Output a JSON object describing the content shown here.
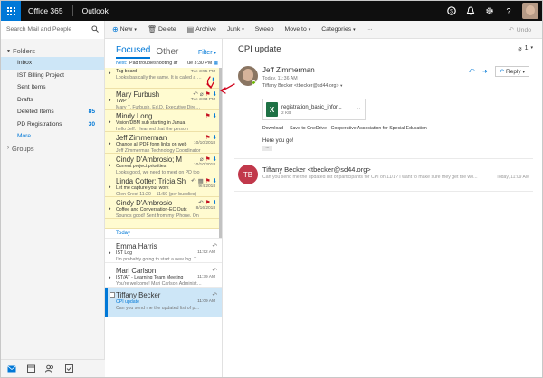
{
  "topbar": {
    "brand": "Office 365",
    "app": "Outlook"
  },
  "commands": {
    "search_placeholder": "Search Mail and People",
    "new": "New",
    "delete": "Delete",
    "archive": "Archive",
    "junk": "Junk",
    "sweep": "Sweep",
    "move_to": "Move to",
    "categories": "Categories",
    "undo": "Undo"
  },
  "nav": {
    "folders_label": "Folders",
    "items": [
      {
        "label": "Inbox",
        "count": ""
      },
      {
        "label": "IST Billing Project",
        "count": ""
      },
      {
        "label": "Sent Items",
        "count": ""
      },
      {
        "label": "Drafts",
        "count": ""
      },
      {
        "label": "Deleted Items",
        "count": "85"
      },
      {
        "label": "PD Registrations",
        "count": "30"
      }
    ],
    "more": "More",
    "groups_label": "Groups"
  },
  "list": {
    "tab_focused": "Focused",
    "tab_other": "Other",
    "filter": "Filter",
    "next_label": "Next:",
    "next_text": "iPad troubleshooting ar",
    "next_time": "Tue 3:30 PM",
    "today_label": "Today",
    "pinned": [
      {
        "from": "",
        "subject": "Tag board",
        "preview": "Looks basically the same. It is called a Tag board.",
        "time": "Tue 3:55 PM"
      },
      {
        "from": "Mary Furbush",
        "subject": "TWP",
        "preview": "Mary T. Furbush, Ed.D. Executive Director, SAU 44",
        "time": "Tue 3:03 PM"
      },
      {
        "from": "Mindy Long",
        "subject": "Vision/DBM sub starting in Janua",
        "preview": "hello Jeff.  I learned that the person",
        "time": ""
      },
      {
        "from": "Jeff Zimmerman",
        "subject": "Change all PDF form links on web",
        "preview": "Jeff Zimmerman Technology Coordinator",
        "time": "10/10/2018"
      },
      {
        "from": "Cindy D'Ambrosio; M",
        "subject": "Current project priorities",
        "preview": "Looks good, we need to meet on PD too",
        "time": "10/10/2018"
      },
      {
        "from": "Linda Cotter; Tricia Sh",
        "subject": "Let me capture your work",
        "preview": "Glen Crest 11:20 – 11:59 (per buddies)",
        "time": "9/4/2018"
      },
      {
        "from": "Cindy D'Ambrosio",
        "subject": "Coffee and Conversation-EC Outc",
        "preview": "Sounds good! Sent from my iPhone. On",
        "time": "8/16/2018"
      }
    ],
    "today": [
      {
        "from": "Emma Harris",
        "subject": "IST Log",
        "preview": "I'm probably going to start a new log. This",
        "time": "11:52 AM"
      },
      {
        "from": "Mari Carlson",
        "subject": "IST/AT - Learning Team Meeting",
        "preview": "You're welcome! Mari Carlson Administrative",
        "time": "11:39 AM"
      },
      {
        "from": "Tiffany Becker",
        "subject": "CPI update",
        "preview": "Can you send me the updated list of partici",
        "time": "11:09 AM"
      }
    ]
  },
  "reading": {
    "title": "CPI update",
    "count": "1",
    "sender_name": "Jeff Zimmerman",
    "sender_time": "Today, 11:36 AM",
    "sender_to": "Tiffany Becker <tbecker@sd44.org>",
    "reply_label": "Reply",
    "attachment_name": "registration_basic_infor...",
    "attachment_size": "2 KB",
    "att_download": "Download",
    "att_save": "Save to OneDrive - Cooperative Association for Special Education",
    "body": "Here you go!",
    "ellipsis": "...",
    "prev_initials": "TB",
    "prev_from": "Tiffany Becker <tbecker@sd44.org>",
    "prev_text": "Can you send me the updated list of participants for CPI on 11/1? I want to make sure they get the wo...",
    "prev_time": "Today, 11:09 AM"
  },
  "colors": {
    "accent": "#0078d7",
    "pinned_bg": "#fffbd0",
    "flag": "#c50f1f",
    "topbar": "#0f0f0f",
    "annotation": "#d0021b"
  }
}
